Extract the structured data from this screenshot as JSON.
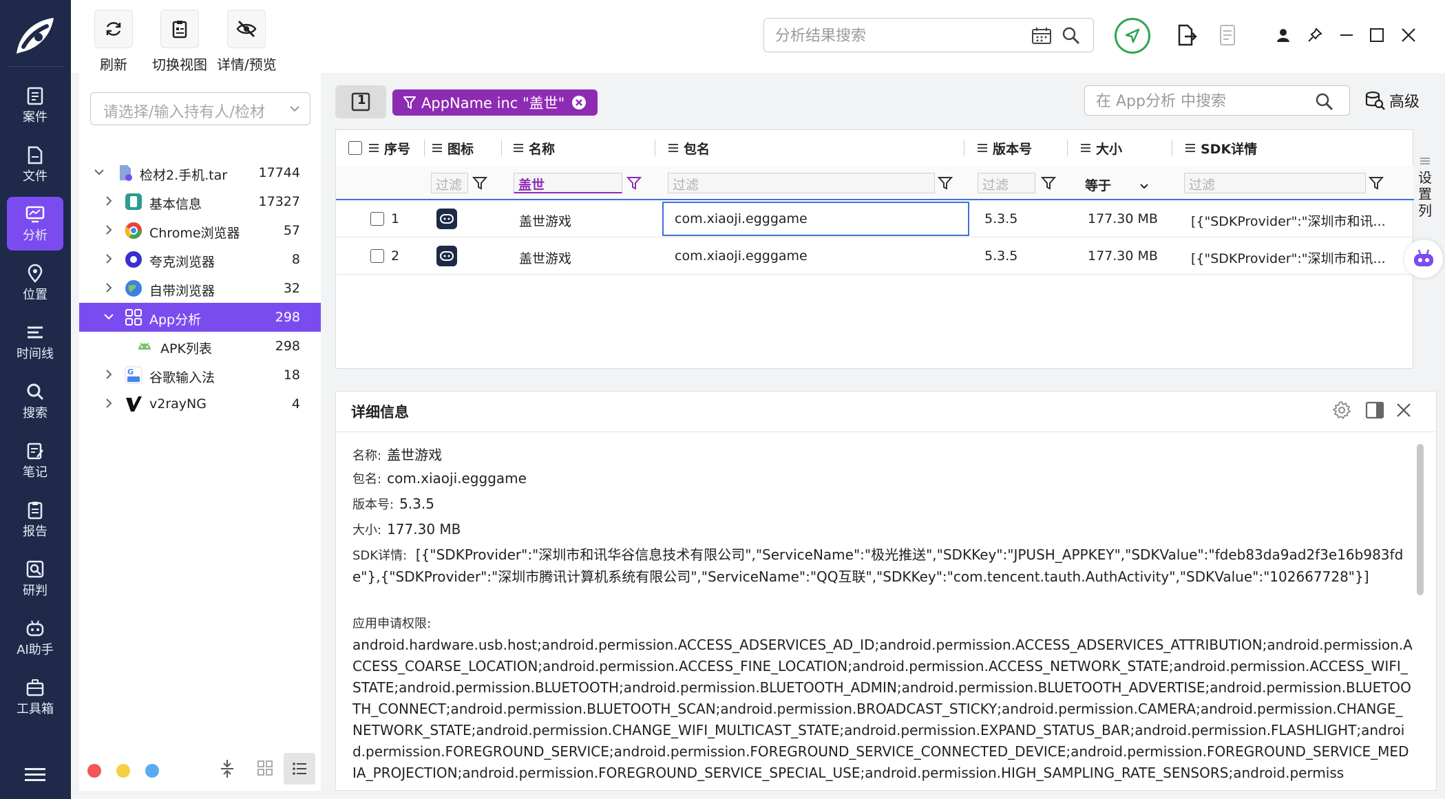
{
  "nav": {
    "items": [
      {
        "label": "案件",
        "icon": "briefcase-icon"
      },
      {
        "label": "文件",
        "icon": "file-icon"
      },
      {
        "label": "分析",
        "icon": "analysis-icon"
      },
      {
        "label": "位置",
        "icon": "location-icon"
      },
      {
        "label": "时间线",
        "icon": "timeline-icon"
      },
      {
        "label": "搜索",
        "icon": "search-icon"
      },
      {
        "label": "笔记",
        "icon": "note-icon"
      },
      {
        "label": "报告",
        "icon": "report-icon"
      },
      {
        "label": "研判",
        "icon": "judge-icon"
      },
      {
        "label": "AI助手",
        "icon": "robot-icon"
      },
      {
        "label": "工具箱",
        "icon": "toolbox-icon"
      }
    ],
    "active": "分析",
    "accent": "#7a4cf0",
    "bg": "#1f2a4a"
  },
  "toolbar": {
    "refresh": "刷新",
    "switch_view": "切换视图",
    "detail_preview": "详情/预览",
    "search_placeholder": "分析结果搜索"
  },
  "sidebar": {
    "holder_placeholder": "请选择/输入持有人/检材",
    "tree": [
      {
        "label": "检材2.手机.tar",
        "count": "17744",
        "level": 0,
        "expanded": true
      },
      {
        "label": "基本信息",
        "count": "17327",
        "level": 1
      },
      {
        "label": "Chrome浏览器",
        "count": "57",
        "level": 1
      },
      {
        "label": "夸克浏览器",
        "count": "8",
        "level": 1
      },
      {
        "label": "自带浏览器",
        "count": "32",
        "level": 1
      },
      {
        "label": "App分析",
        "count": "298",
        "level": 1,
        "expanded": true,
        "selected": true
      },
      {
        "label": "APK列表",
        "count": "298",
        "level": 2
      },
      {
        "label": "谷歌输入法",
        "count": "18",
        "level": 1
      },
      {
        "label": "v2rayNG",
        "count": "4",
        "level": 1
      }
    ]
  },
  "filterbar": {
    "page": "1",
    "chip": "AppName inc \"盖世\"",
    "app_search_placeholder": "在 App分析 中搜索",
    "advanced": "高级"
  },
  "grid": {
    "columns": [
      "序号",
      "图标",
      "名称",
      "包名",
      "版本号",
      "大小",
      "SDK详情"
    ],
    "filters": {
      "placeholder": "过滤",
      "name_value": "盖世",
      "size_op": "等于"
    },
    "rows": [
      {
        "index": "1",
        "name": "盖世游戏",
        "package": "com.xiaoji.egggame",
        "version": "5.3.5",
        "size": "177.30 MB",
        "sdk": "[{\"SDKProvider\":\"深圳市和讯..."
      },
      {
        "index": "2",
        "name": "盖世游戏",
        "package": "com.xiaoji.egggame",
        "version": "5.3.5",
        "size": "177.30 MB",
        "sdk": "[{\"SDKProvider\":\"深圳市和讯..."
      }
    ],
    "settings_col": "设置列"
  },
  "detail": {
    "title": "详细信息",
    "name_key": "名称:",
    "name": "盖世游戏",
    "package_key": "包名:",
    "package": "com.xiaoji.egggame",
    "version_key": "版本号:",
    "version": "5.3.5",
    "size_key": "大小:",
    "size": "177.30 MB",
    "sdk_key": "SDK详情:",
    "sdk": "[{\"SDKProvider\":\"深圳市和讯华谷信息技术有限公司\",\"ServiceName\":\"极光推送\",\"SDKKey\":\"JPUSH_APPKEY\",\"SDKValue\":\"fdeb83da9ad2f3e16b983fde\"},{\"SDKProvider\":\"深圳市腾讯计算机系统有限公司\",\"ServiceName\":\"QQ互联\",\"SDKKey\":\"com.tencent.tauth.AuthActivity\",\"SDKValue\":\"102667728\"}]",
    "perm_key": "应用申请权限:",
    "permissions": "android.hardware.usb.host;android.permission.ACCESS_ADSERVICES_AD_ID;android.permission.ACCESS_ADSERVICES_ATTRIBUTION;android.permission.ACCESS_COARSE_LOCATION;android.permission.ACCESS_FINE_LOCATION;android.permission.ACCESS_NETWORK_STATE;android.permission.ACCESS_WIFI_STATE;android.permission.BLUETOOTH;android.permission.BLUETOOTH_ADMIN;android.permission.BLUETOOTH_ADVERTISE;android.permission.BLUETOOTH_CONNECT;android.permission.BLUETOOTH_SCAN;android.permission.BROADCAST_STICKY;android.permission.CAMERA;android.permission.CHANGE_NETWORK_STATE;android.permission.CHANGE_WIFI_MULTICAST_STATE;android.permission.EXPAND_STATUS_BAR;android.permission.FLASHLIGHT;android.permission.FOREGROUND_SERVICE;android.permission.FOREGROUND_SERVICE_CONNECTED_DEVICE;android.permission.FOREGROUND_SERVICE_MEDIA_PROJECTION;android.permission.FOREGROUND_SERVICE_SPECIAL_USE;android.permission.HIGH_SAMPLING_RATE_SENSORS;android.permiss"
  }
}
